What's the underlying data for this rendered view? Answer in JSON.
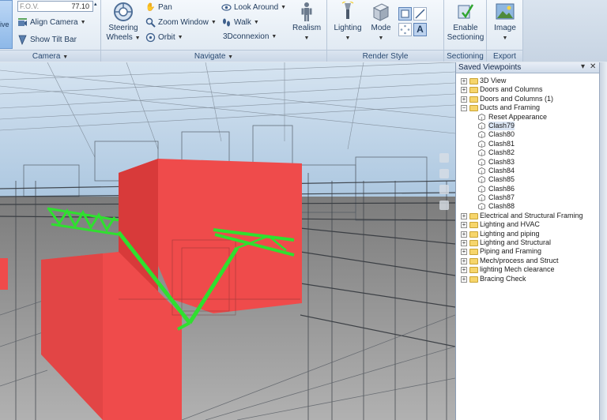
{
  "ribbon": {
    "camera": {
      "fov_label": "F.O.V.",
      "fov_value": "77.10",
      "active_label": "ive",
      "align_camera": "Align Camera",
      "show_tilt_bar": "Show Tilt Bar",
      "title": "Camera"
    },
    "navigate": {
      "steering_wheels_1": "Steering",
      "steering_wheels_2": "Wheels",
      "pan": "Pan",
      "zoom_window": "Zoom Window",
      "orbit": "Orbit",
      "look_around": "Look Around",
      "walk": "Walk",
      "connexion": "3Dconnexion",
      "realism": "Realism",
      "title": "Navigate"
    },
    "render_style": {
      "lighting": "Lighting",
      "mode": "Mode",
      "title": "Render Style"
    },
    "sectioning": {
      "enable_1": "Enable",
      "enable_2": "Sectioning",
      "title": "Sectioning"
    },
    "export": {
      "image": "Image",
      "title": "Export"
    }
  },
  "saved_viewpoints": {
    "title": "Saved Viewpoints",
    "items": [
      {
        "label": "3D View",
        "type": "folder",
        "level": 0
      },
      {
        "label": "Doors and Columns",
        "type": "folder",
        "level": 0
      },
      {
        "label": "Doors and Columns (1)",
        "type": "folder",
        "level": 0
      },
      {
        "label": "Ducts and Framing",
        "type": "folder",
        "level": 0,
        "expanded": true
      },
      {
        "label": "Reset Appearance",
        "type": "viewpoint",
        "level": 1
      },
      {
        "label": "Clash79",
        "type": "viewpoint",
        "level": 1,
        "selected": true
      },
      {
        "label": "Clash80",
        "type": "viewpoint",
        "level": 1
      },
      {
        "label": "Clash81",
        "type": "viewpoint",
        "level": 1
      },
      {
        "label": "Clash82",
        "type": "viewpoint",
        "level": 1
      },
      {
        "label": "Clash83",
        "type": "viewpoint",
        "level": 1
      },
      {
        "label": "Clash84",
        "type": "viewpoint",
        "level": 1
      },
      {
        "label": "Clash85",
        "type": "viewpoint",
        "level": 1
      },
      {
        "label": "Clash86",
        "type": "viewpoint",
        "level": 1
      },
      {
        "label": "Clash87",
        "type": "viewpoint",
        "level": 1
      },
      {
        "label": "Clash88",
        "type": "viewpoint",
        "level": 1
      },
      {
        "label": "Electrical and Structural Framing",
        "type": "folder",
        "level": 0
      },
      {
        "label": "Lighting and HVAC",
        "type": "folder",
        "level": 0
      },
      {
        "label": "Lighting and piping",
        "type": "folder",
        "level": 0
      },
      {
        "label": "Lighting and Structural",
        "type": "folder",
        "level": 0
      },
      {
        "label": "Piping and Framing",
        "type": "folder",
        "level": 0
      },
      {
        "label": "Mech/process and Struct",
        "type": "folder",
        "level": 0
      },
      {
        "label": "lighting Mech clearance",
        "type": "folder",
        "level": 0
      },
      {
        "label": "Bracing Check",
        "type": "folder",
        "level": 0
      }
    ]
  },
  "colors": {
    "clash_red": "#ef4b4b",
    "steel_green": "#2fe02f",
    "sky": "#c9dbec"
  }
}
